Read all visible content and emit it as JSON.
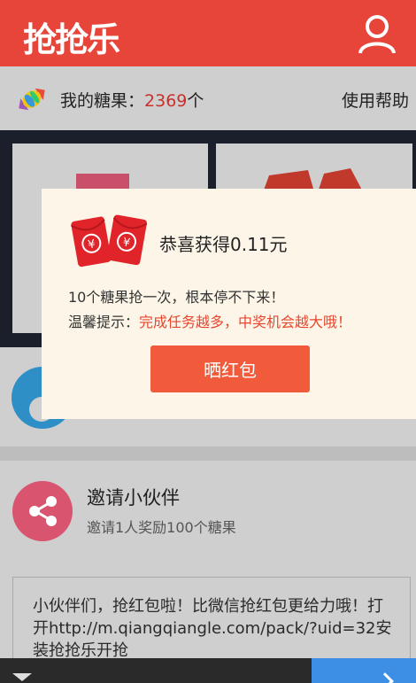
{
  "header": {
    "logo_text": "抢抢乐",
    "user_icon": "user-icon",
    "background": "#e8453a"
  },
  "candy": {
    "icon": "candy-icon",
    "label": "我的糖果：",
    "count": "2369",
    "unit": "个",
    "help_label": "使用帮助",
    "count_color": "#c9302c"
  },
  "invite": {
    "icon": "share-icon",
    "title": "邀请小伙伴",
    "subtitle": "邀请1人奖励100个糖果"
  },
  "share_message": "小伙伴们，抢红包啦！比微信抢红包更给力哦！打开http://m.qiangqiangle.com/pack/?uid=32安装抢抢乐开抢",
  "dialog": {
    "icon": "red-envelope-icon",
    "title": "恭喜获得0.11元",
    "line1": "10个糖果抢一次，根本停不下来！",
    "hint_label": "温馨提示：",
    "hint_value": "完成任务越多，中奖机会越大哦！",
    "button_label": "晒红包",
    "button_color": "#f25a3c"
  }
}
